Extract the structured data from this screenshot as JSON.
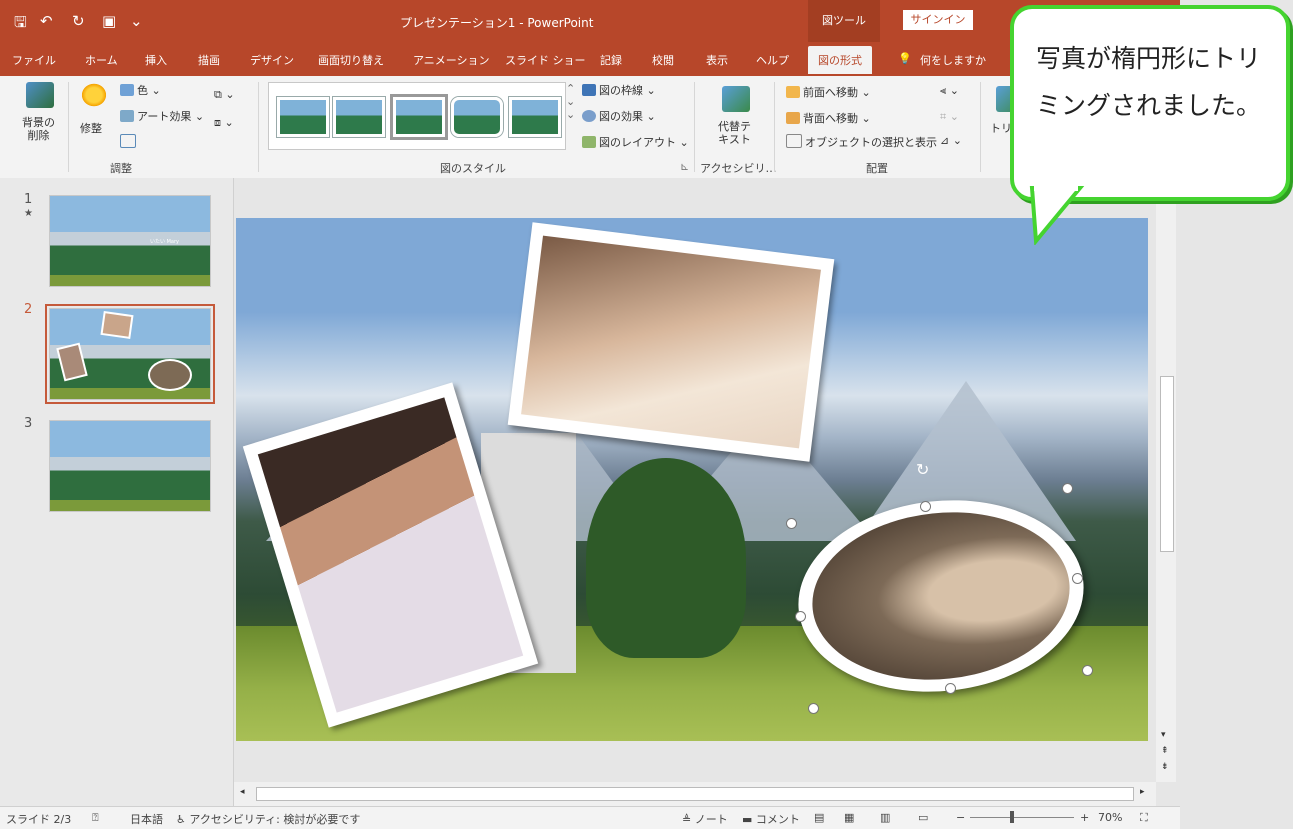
{
  "window": {
    "title": "プレゼンテーション1 - PowerPoint",
    "context_tab_header": "図ツール",
    "signin": "サインイン"
  },
  "tabs": [
    "ファイル",
    "ホーム",
    "挿入",
    "描画",
    "デザイン",
    "画面切り替え",
    "アニメーション",
    "スライド ショー",
    "記録",
    "校閲",
    "表示",
    "ヘルプ",
    "図の形式"
  ],
  "tell_me": "何をしますか",
  "ribbon": {
    "remove_bg": "背景の\n削除",
    "corrections": "修整",
    "color": "色",
    "art_effects": "アート効果",
    "group_adjust": "調整",
    "border": "図の枠線",
    "effects": "図の効果",
    "layout": "図のレイアウト",
    "group_styles": "図のスタイル",
    "alt_text": "代替テ\nキスト",
    "group_access": "アクセシビリ…",
    "bring_forward": "前面へ移動",
    "send_backward": "背面へ移動",
    "selection_pane": "オブジェクトの選択と表示",
    "group_arrange": "配置",
    "crop_partial": "トリ"
  },
  "slides": [
    {
      "num": "1",
      "star": "★",
      "caption": "いたい Mary"
    },
    {
      "num": "2"
    },
    {
      "num": "3"
    }
  ],
  "status": {
    "slide": "スライド 2/3",
    "lang": "日本語",
    "accessibility": "アクセシビリティ: 検討が必要です",
    "notes": "ノート",
    "comments": "コメント",
    "zoom": "70%"
  },
  "callout": {
    "text": "写真が楕円形にトリミングされました。"
  },
  "colors": {
    "accent": "#b7472a",
    "callout_border": "#45d430"
  }
}
